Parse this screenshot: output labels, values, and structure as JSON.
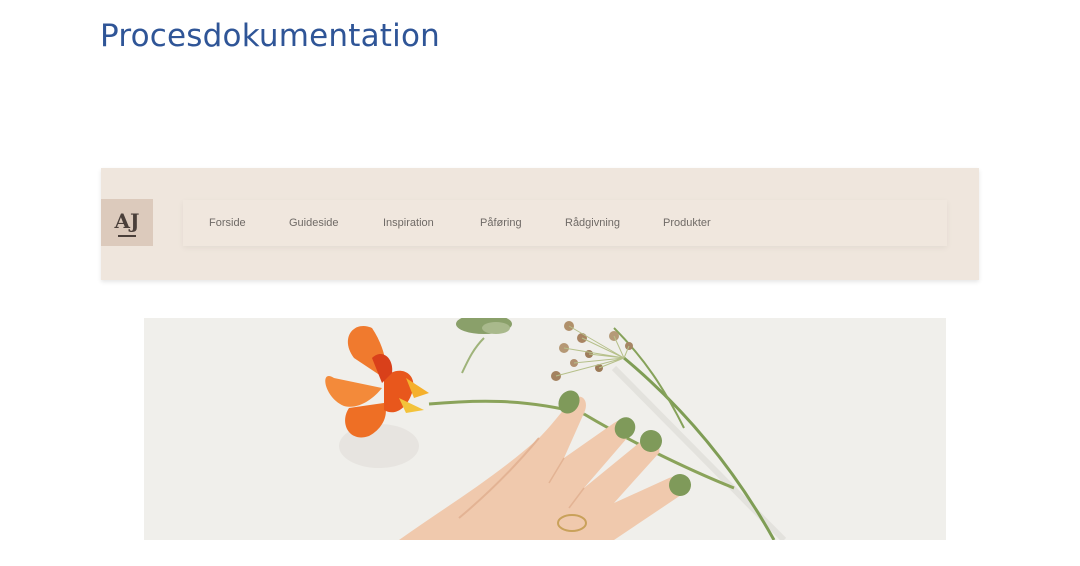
{
  "document": {
    "title": "Procesdokumentation"
  },
  "site_header": {
    "logo_text": "AJ",
    "nav_items": [
      {
        "label": "Forside"
      },
      {
        "label": "Guideside"
      },
      {
        "label": "Inspiration"
      },
      {
        "label": "Påføring"
      },
      {
        "label": "Rådgivning"
      },
      {
        "label": "Produkter"
      }
    ]
  },
  "hero": {
    "image": "hand-with-green-nail-polish-and-orange-nasturtium-flower"
  },
  "colors": {
    "title": "#2f5597",
    "header_bg": "#efe6dd",
    "logo_bg": "#dccabc",
    "nail_green": "#7f9a5a",
    "flower_orange": "#f07a2e"
  }
}
